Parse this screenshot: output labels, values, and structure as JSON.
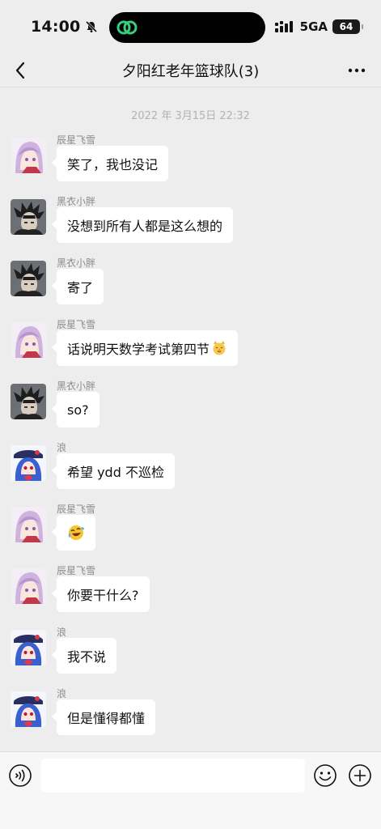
{
  "status": {
    "time": "14:00",
    "network": "5GA",
    "battery": "64"
  },
  "nav": {
    "title": "夕阳红老年篮球队(3)"
  },
  "chat": {
    "timestamp": "2022 年 3月15日 22:32",
    "messages": [
      {
        "sender": "辰星飞雪",
        "text": "笑了，我也没记",
        "avatar": "pink-hair"
      },
      {
        "sender": "黑衣小胖",
        "text": "没想到所有人都是这么想的",
        "avatar": "dark-hair"
      },
      {
        "sender": "黑衣小胖",
        "text": "寄了",
        "avatar": "dark-hair"
      },
      {
        "sender": "辰星飞雪",
        "text": "话说明天数学考试第四节",
        "emoji": "cat-face-icon",
        "avatar": "pink-hair"
      },
      {
        "sender": "黑衣小胖",
        "text": "so?",
        "avatar": "dark-hair"
      },
      {
        "sender": "浪",
        "text": "希望 ydd 不巡检",
        "avatar": "blue-hair"
      },
      {
        "sender": "辰星飞雪",
        "text": "",
        "emoji": "laughing-crying-icon",
        "avatar": "pink-hair"
      },
      {
        "sender": "辰星飞雪",
        "text": "你要干什么?",
        "avatar": "pink-hair"
      },
      {
        "sender": "浪",
        "text": "我不说",
        "avatar": "blue-hair"
      },
      {
        "sender": "浪",
        "text": "但是懂得都懂",
        "avatar": "blue-hair"
      }
    ]
  },
  "input": {
    "value": "",
    "placeholder": ""
  },
  "colors": {
    "background": "#ededed",
    "bubble": "#ffffff",
    "sender": "#8c8c8c",
    "timestamp": "#b2b2b2"
  }
}
